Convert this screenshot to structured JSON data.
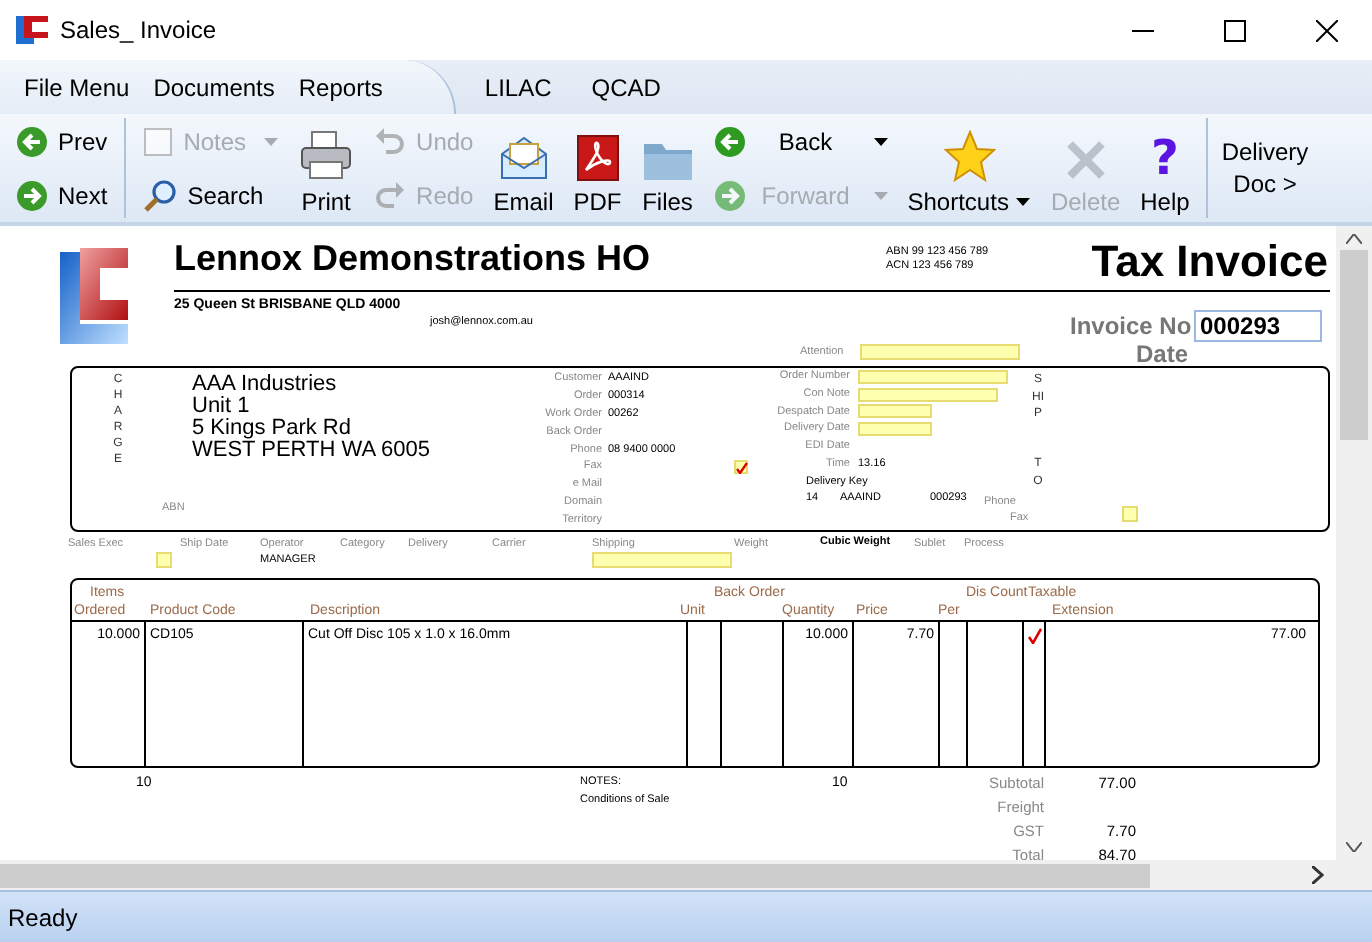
{
  "window": {
    "title": "Sales_ Invoice"
  },
  "menu": [
    {
      "label": "File Menu"
    },
    {
      "label": "Documents"
    },
    {
      "label": "Reports"
    },
    {
      "label": "LILAC"
    },
    {
      "label": "QCAD"
    }
  ],
  "toolbar": {
    "prev": {
      "label": "Prev",
      "disabled": false
    },
    "next": {
      "label": "Next",
      "disabled": false
    },
    "notes": {
      "label": "Notes",
      "disabled": true,
      "dropdown": true
    },
    "search": {
      "label": "Search",
      "disabled": false
    },
    "print": {
      "label": "Print",
      "disabled": false
    },
    "undo": {
      "label": "Undo",
      "disabled": true
    },
    "redo": {
      "label": "Redo",
      "disabled": true
    },
    "email": {
      "label": "Email",
      "disabled": false
    },
    "pdf": {
      "label": "PDF",
      "disabled": false
    },
    "files": {
      "label": "Files",
      "disabled": false
    },
    "back": {
      "label": "Back",
      "disabled": false,
      "dropdown": true
    },
    "forward": {
      "label": "Forward",
      "disabled": true,
      "dropdown": true
    },
    "shortcuts": {
      "label": "Shortcuts",
      "disabled": false,
      "dropdown": true
    },
    "delete": {
      "label": "Delete",
      "disabled": true
    },
    "help": {
      "label": "Help",
      "icon": "?",
      "disabled": false
    },
    "delivery_doc": {
      "lines": [
        "Delivery",
        "Doc >"
      ]
    }
  },
  "invoice": {
    "company": "Lennox Demonstrations HO",
    "address": "25 Queen St BRISBANE QLD 4000",
    "email": "josh@lennox.com.au",
    "abn": [
      "ABN 99 123 456 789",
      "ACN 123 456 789"
    ],
    "title": "Tax Invoice",
    "invoice_no_label": "Invoice No",
    "invoice_no": "000293",
    "date_label": "Date",
    "attention_label": "Attention"
  },
  "charge": {
    "letters": "CHARGE",
    "address": [
      "AAA Industries",
      "Unit 1",
      "5 Kings Park Rd",
      "WEST PERTH WA 6005"
    ],
    "abn_label": "ABN"
  },
  "customer_fields": [
    {
      "label": "Customer",
      "value": "AAAIND"
    },
    {
      "label": "Order",
      "value": "000314"
    },
    {
      "label": "Work Order",
      "value": "00262"
    },
    {
      "label": "Back Order"
    },
    {
      "label": "Phone",
      "value": "08 9400 0000"
    },
    {
      "label": "Fax",
      "kind": "check",
      "checked": true
    },
    {
      "label": "e Mail"
    },
    {
      "label": "Domain"
    },
    {
      "label": "Territory"
    }
  ],
  "order_fields": [
    {
      "label": "Order Number",
      "kind": "field"
    },
    {
      "label": "Con Note",
      "kind": "field"
    },
    {
      "label": "Despatch Date",
      "kind": "field"
    },
    {
      "label": "Delivery Date",
      "kind": "field"
    },
    {
      "label": "EDI Date",
      "kind": "text"
    },
    {
      "label": "Time",
      "kind": "text",
      "value": "13.16"
    }
  ],
  "delivery_key": {
    "label": "Delivery Key",
    "values": [
      "14",
      "AAAIND",
      "000293"
    ]
  },
  "ship": {
    "letters": [
      "SHIP",
      "TO"
    ],
    "phone_label": "Phone",
    "fax_label": "Fax"
  },
  "details_row": [
    {
      "label": "Sales Exec",
      "kind": "box"
    },
    {
      "label": "Ship Date",
      "kind": "text"
    },
    {
      "label": "Operator",
      "kind": "text",
      "value": "MANAGER"
    },
    {
      "label": "Category",
      "kind": "text"
    },
    {
      "label": "Delivery",
      "kind": "text"
    },
    {
      "label": "Carrier",
      "kind": "text"
    },
    {
      "label": "Shipping",
      "kind": "field"
    },
    {
      "label": "Weight",
      "kind": "text"
    },
    {
      "label": "Cubic Weight",
      "kind": "strong"
    },
    {
      "label": "Sublet",
      "kind": "text"
    },
    {
      "label": "Process",
      "kind": "text"
    }
  ],
  "table": {
    "top_headers": [
      "Items",
      "Back Order",
      "Dis Count",
      "Taxable"
    ],
    "headers": [
      "Ordered",
      "Product Code",
      "Description",
      "Unit",
      "Quantity",
      "Price",
      "Per",
      "Extension"
    ],
    "rows": [
      {
        "ordered": "10.000",
        "code": "CD105",
        "description": "Cut Off Disc 105 x 1.0 x 16.0mm",
        "quantity": "10.000",
        "price": "7.70",
        "taxable": true,
        "extension": "77.00"
      }
    ]
  },
  "footer": {
    "items_total": "10",
    "notes_label": "NOTES:",
    "notes": "Conditions of Sale",
    "quantity_total": "10",
    "totals": [
      {
        "label": "Subtotal",
        "value": "77.00"
      },
      {
        "label": "Freight"
      },
      {
        "label": "GST",
        "value": "7.70"
      },
      {
        "label": "Total",
        "value": "84.70"
      }
    ]
  },
  "status_bar": {
    "text": "Ready"
  }
}
